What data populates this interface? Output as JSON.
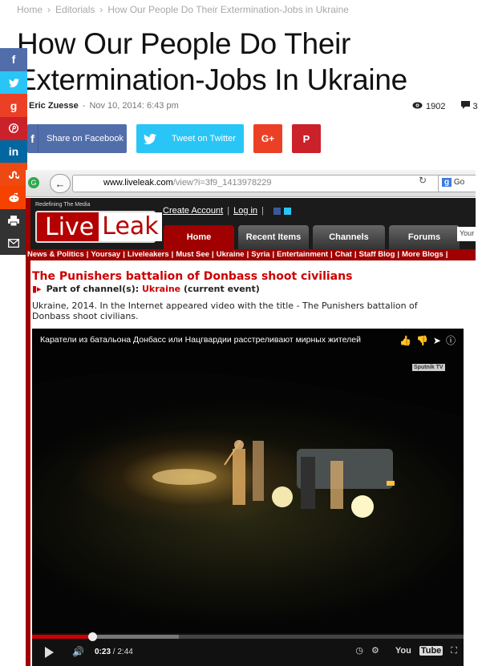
{
  "breadcrumb": {
    "home": "Home",
    "section": "Editorials",
    "current": "How Our People Do Their Extermination-Jobs in Ukraine",
    "separator": "›"
  },
  "article": {
    "title": "How Our People Do Their Extermination-Jobs In Ukraine",
    "author": "Eric Zuesse",
    "date": "Nov 10, 2014: 6:43 pm",
    "views": "1902",
    "comments": "3"
  },
  "share": {
    "facebook_label": "Share on Facebook",
    "twitter_label": "Tweet on Twitter",
    "googleplus_glyph": "G+",
    "pinterest_glyph": "P"
  },
  "side_share": [
    "facebook-icon",
    "twitter-icon",
    "googleplus-icon",
    "pinterest-icon",
    "linkedin-icon",
    "stumbleupon-icon",
    "reddit-icon",
    "print-icon",
    "email-icon"
  ],
  "browser": {
    "url_host": "www.liveleak.com",
    "url_path": "/view?i=3f9_1413978229",
    "search_placeholder": "Go"
  },
  "liveleak": {
    "tagline": "Redefining The Media",
    "logo_live": "Live",
    "logo_leak": "Leak",
    "create_account": "Create Account",
    "login": "Log in",
    "link_sep": "|",
    "search_placeholder": "Your s",
    "tabs": [
      "Home",
      "Recent Items",
      "Channels",
      "Forums"
    ],
    "nav": [
      "News & Politics",
      "Yoursay",
      "Liveleakers",
      "Must See",
      "Ukraine",
      "Syria",
      "Entertainment",
      "Chat",
      "Staff Blog",
      "More Blogs"
    ],
    "item_title": "The Punishers battalion of Donbass shoot civilians",
    "channel_prefix": "Part of channel(s):",
    "channel_name": "Ukraine",
    "channel_suffix": "(current event)",
    "description": "Ukraine, 2014. In the Internet appeared video with the title - The Punishers battalion of Donbass shoot civilians."
  },
  "video": {
    "title": "Каратели из батальона Донбасс или Нацгвардии расстреливают мирных жителей",
    "watermark": "Sputnik TV",
    "current_time": "0:23",
    "duration": "2:44",
    "time_sep": "/",
    "progress_fraction": 0.14,
    "buffered_fraction": 0.34,
    "brand_you": "You",
    "brand_tube": "Tube"
  },
  "colors": {
    "facebook": "#516eab",
    "twitter": "#29c5f6",
    "googleplus": "#eb4026",
    "pinterest": "#ca212a",
    "liveleak_red": "#a00000"
  }
}
